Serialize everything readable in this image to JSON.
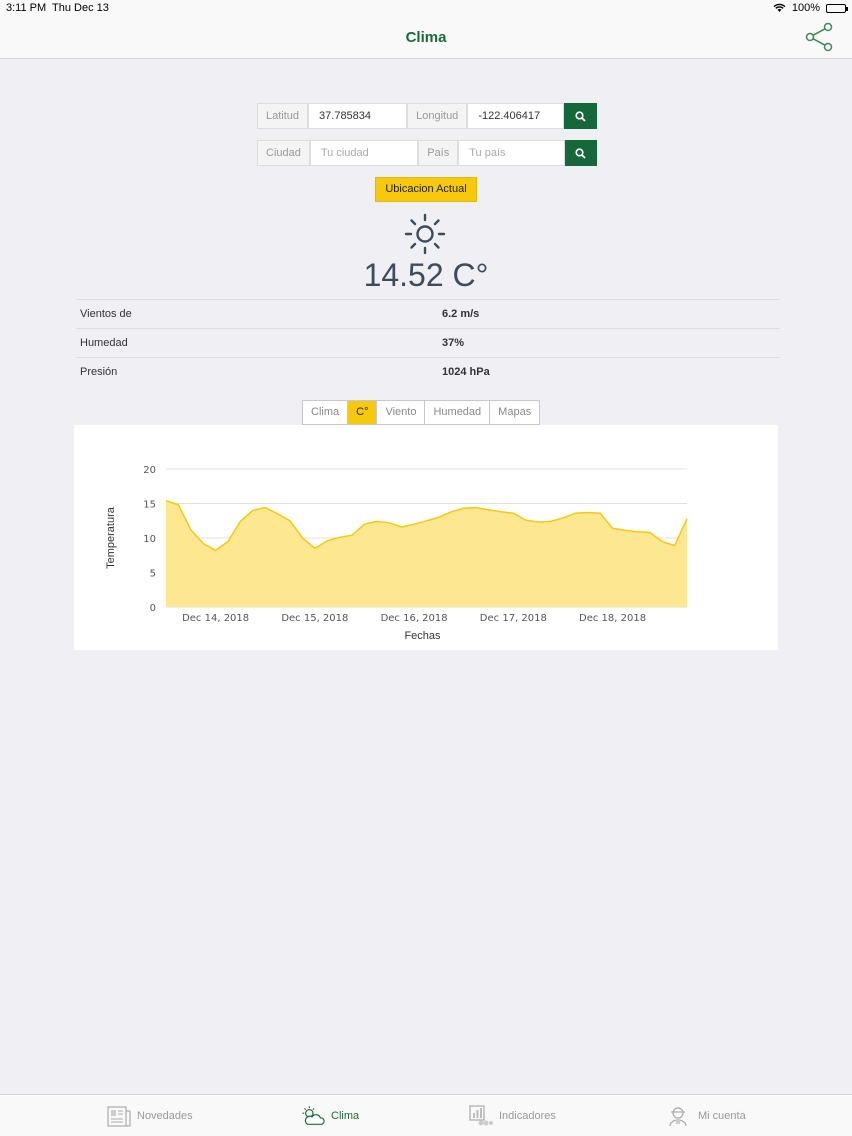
{
  "status": {
    "time": "3:11 PM",
    "date": "Thu Dec 13",
    "battery": "100%"
  },
  "nav": {
    "title": "Clima"
  },
  "search": {
    "lat_label": "Latitud",
    "lat_value": "37.785834",
    "lng_label": "Longitud",
    "lng_value": "-122.406417",
    "city_label": "Ciudad",
    "city_placeholder": "Tu ciudad",
    "country_label": "País",
    "country_placeholder": "Tu país"
  },
  "location_button": "Ubicacion Actual",
  "weather": {
    "icon": "sun-icon",
    "temperature": "14.52 C°",
    "rows": [
      {
        "label": "Vientos de",
        "value": "6.2 m/s"
      },
      {
        "label": "Humedad",
        "value": "37%"
      },
      {
        "label": "Presión",
        "value": "1024 hPa"
      }
    ]
  },
  "tabs": [
    "Clima",
    "C°",
    "Viento",
    "Humedad",
    "Mapas"
  ],
  "active_tab": 1,
  "colors": {
    "brand_green": "#1a6b35",
    "accent_yellow": "#f6c90e",
    "area_fill": "#fde68a",
    "area_line": "#f6c90e"
  },
  "chart_data": {
    "type": "area",
    "xlabel": "Fechas",
    "ylabel": "Temperatura",
    "ylim": [
      0,
      20
    ],
    "yticks": [
      0,
      5,
      10,
      15,
      20
    ],
    "xticks": [
      "Dec 14, 2018",
      "Dec 15, 2018",
      "Dec 16, 2018",
      "Dec 17, 2018",
      "Dec 18, 2018"
    ],
    "x_start": "Dec 13, 2018 12:00",
    "x_step_hours": 3,
    "values": [
      15.4,
      14.8,
      11.2,
      9.2,
      8.2,
      9.5,
      12.4,
      14.0,
      14.4,
      13.5,
      12.5,
      10.0,
      8.5,
      9.6,
      10.1,
      10.4,
      12.0,
      12.4,
      12.2,
      11.6,
      12.0,
      12.5,
      13.0,
      13.8,
      14.3,
      14.4,
      14.1,
      13.8,
      13.6,
      12.6,
      12.3,
      12.4,
      12.9,
      13.6,
      13.7,
      13.6,
      11.4,
      11.1,
      10.9,
      10.8,
      9.5,
      8.9,
      12.8
    ]
  },
  "tabbar": [
    {
      "label": "Novedades",
      "icon": "newspaper-icon"
    },
    {
      "label": "Clima",
      "icon": "weather-icon"
    },
    {
      "label": "Indicadores",
      "icon": "chart-icon"
    },
    {
      "label": "Mi cuenta",
      "icon": "user-icon"
    }
  ]
}
